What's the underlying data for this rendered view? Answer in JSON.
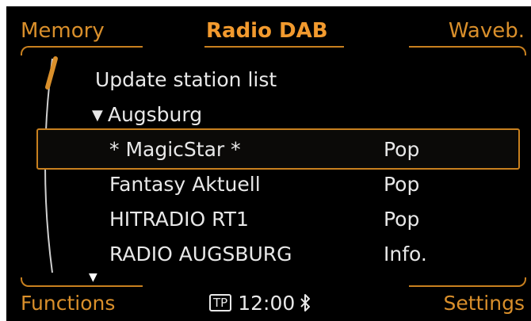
{
  "header": {
    "left_tab": "Memory",
    "center_title": "Radio DAB",
    "right_tab": "Waveb."
  },
  "list": {
    "items": [
      {
        "label": "Update station list",
        "genre": ""
      },
      {
        "label": "Augsburg",
        "genre": "",
        "expanded": true
      },
      {
        "label": "* MagicStar *",
        "genre": "Pop",
        "selected": true
      },
      {
        "label": "Fantasy Aktuell",
        "genre": "Pop"
      },
      {
        "label": "HITRADIO RT1",
        "genre": "Pop"
      },
      {
        "label": "RADIO AUGSBURG",
        "genre": "Info."
      }
    ],
    "expand_marker": "▼",
    "more_marker": "▼"
  },
  "footer": {
    "left": "Functions",
    "tp_badge": "TP",
    "time": "12:00",
    "bluetooth_icon": "bluetooth-icon",
    "right": "Settings"
  },
  "colors": {
    "background": "#000000",
    "accent": "#d98f2b",
    "text": "#e8e8e8"
  }
}
